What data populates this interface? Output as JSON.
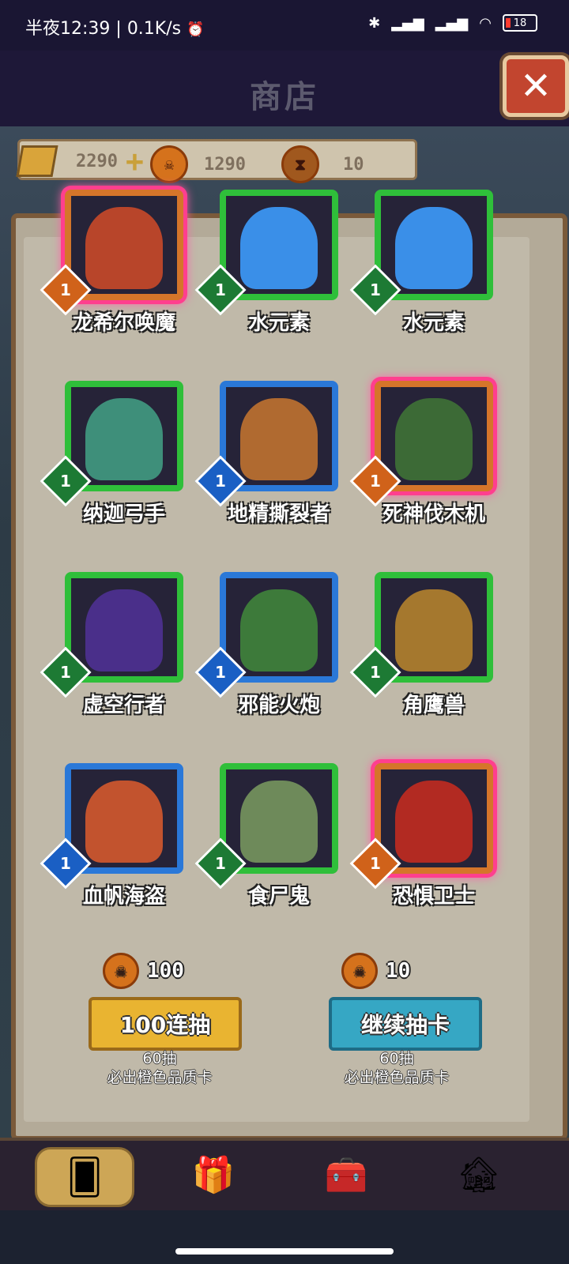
{
  "status_bar": {
    "time": "半夜12:39",
    "speed": "0.1K/s",
    "battery": "18"
  },
  "header": {
    "title": "商店",
    "close_label": "✕"
  },
  "resources": {
    "gold": "2290",
    "tokens": "1290",
    "hourglass": "10"
  },
  "cards": [
    {
      "name": "龙希尔唤魔",
      "level": "1",
      "rarity": "orange",
      "art_color": "#b8452a"
    },
    {
      "name": "水元素",
      "level": "1",
      "rarity": "green",
      "art_color": "#3a8fe8"
    },
    {
      "name": "水元素",
      "level": "1",
      "rarity": "green",
      "art_color": "#3a8fe8"
    },
    {
      "name": "纳迦弓手",
      "level": "1",
      "rarity": "green",
      "art_color": "#3e8f7a"
    },
    {
      "name": "地精撕裂者",
      "level": "1",
      "rarity": "blue",
      "art_color": "#b06a30"
    },
    {
      "name": "死神伐木机",
      "level": "1",
      "rarity": "orange",
      "art_color": "#3c6a36"
    },
    {
      "name": "虚空行者",
      "level": "1",
      "rarity": "green",
      "art_color": "#4a2f8a"
    },
    {
      "name": "邪能火炮",
      "level": "1",
      "rarity": "blue",
      "art_color": "#3d7a3a"
    },
    {
      "name": "角鹰兽",
      "level": "1",
      "rarity": "green",
      "art_color": "#a5782e"
    },
    {
      "name": "血帆海盗",
      "level": "1",
      "rarity": "blue",
      "art_color": "#c2532e"
    },
    {
      "name": "食尸鬼",
      "level": "1",
      "rarity": "green",
      "art_color": "#6e8a5a"
    },
    {
      "name": "恐惧卫士",
      "level": "1",
      "rarity": "orange",
      "art_color": "#b22a22"
    }
  ],
  "draw": {
    "left": {
      "cost": "100",
      "button": "100连抽",
      "hint_line1": "60抽",
      "hint_line2": "必出橙色品质卡"
    },
    "right": {
      "cost": "10",
      "button": "继续抽卡",
      "hint_line1": "60抽",
      "hint_line2": "必出橙色品质卡"
    }
  },
  "nav": {
    "items": [
      {
        "icon": "card-deck-icon"
      },
      {
        "icon": "gift-box-icon"
      },
      {
        "icon": "treasure-chest-icon"
      },
      {
        "icon": "village-house-icon"
      }
    ]
  }
}
